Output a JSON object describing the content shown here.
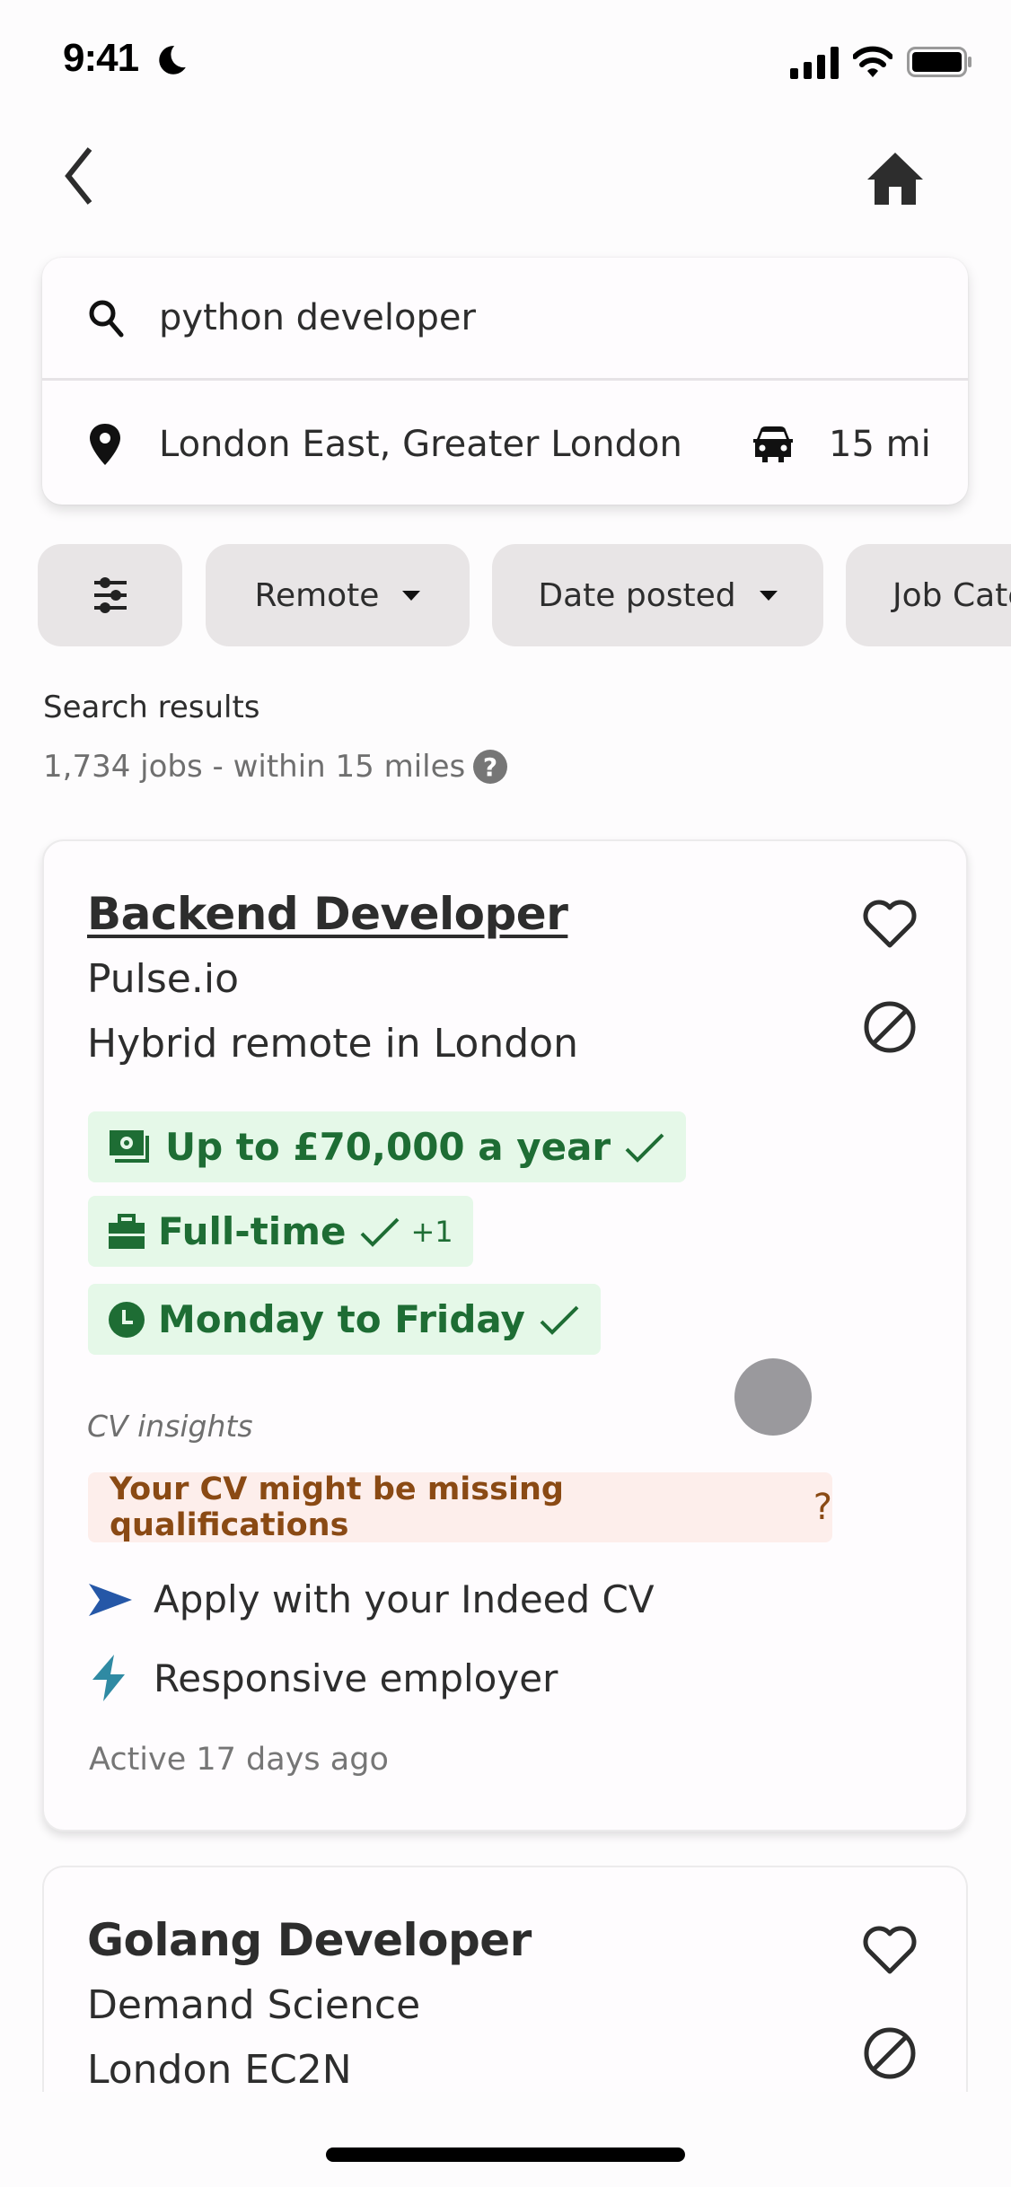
{
  "status_bar": {
    "time": "9:41",
    "focus_icon": "moon-icon",
    "icons": [
      "signal-icon",
      "wifi-icon",
      "battery-icon"
    ]
  },
  "nav": {
    "back_icon": "chevron-left-icon",
    "home_icon": "home-icon"
  },
  "search": {
    "what_value": "python developer",
    "where_value": "London East, Greater London",
    "distance_value": "15 mi"
  },
  "filters": {
    "filter_icon": "sliders-icon",
    "chips": [
      {
        "label": "Remote"
      },
      {
        "label": "Date posted"
      },
      {
        "label": "Job Category"
      }
    ]
  },
  "results": {
    "title": "Search results",
    "count_text": "1,734 jobs - within 15 miles",
    "help_symbol": "?"
  },
  "jobs": [
    {
      "title": "Backend Developer",
      "company": "Pulse.io",
      "location": "Hybrid remote in London",
      "tags": [
        {
          "icon": "money-icon",
          "text": "Up to £70,000 a year",
          "matched": true
        },
        {
          "icon": "briefcase-icon",
          "text": "Full-time",
          "matched": true,
          "extra": "+1"
        },
        {
          "icon": "clock-icon",
          "text": "Monday to Friday",
          "matched": true
        }
      ],
      "cv_insights_label": "CV insights",
      "cv_warning": "Your CV might be missing qualifications",
      "cv_warning_help": "?",
      "features": [
        {
          "icon": "send-arrow-icon",
          "text": "Apply with your Indeed CV",
          "color": "#2557a7"
        },
        {
          "icon": "lightning-icon",
          "text": "Responsive employer",
          "color": "#2f8aa3"
        }
      ],
      "activity": "Active 17 days ago"
    },
    {
      "title": "Golang Developer",
      "company": "Demand Science",
      "location": "London EC2N"
    }
  ],
  "colors": {
    "tag_bg": "#e5f8e8",
    "tag_text": "#1e6d34",
    "warning_bg": "#fdeeeb",
    "warning_text": "#8a4a14",
    "chip_bg": "#e8e5e6"
  }
}
